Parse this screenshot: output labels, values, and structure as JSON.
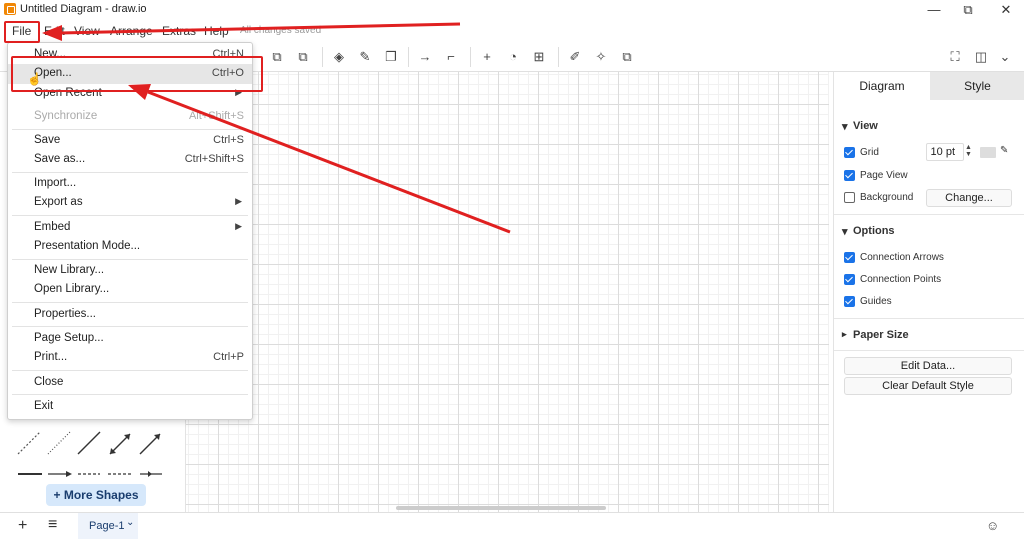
{
  "window": {
    "title": "Untitled Diagram - draw.io",
    "minimize": "—",
    "maximize": "⧉",
    "close": "✕"
  },
  "menubar": {
    "items": [
      "File",
      "Edit",
      "View",
      "Arrange",
      "Extras",
      "Help"
    ],
    "saved_status": "All changes saved"
  },
  "file_menu": {
    "items": [
      {
        "label": "New...",
        "shortcut": "Ctrl+N"
      },
      {
        "label": "Open...",
        "shortcut": "Ctrl+O"
      },
      {
        "label": "Open Recent",
        "submenu": "▶"
      },
      {
        "label": "Synchronize",
        "shortcut": "Alt+Shift+S"
      },
      {
        "label": "Save",
        "shortcut": "Ctrl+S"
      },
      {
        "label": "Save as...",
        "shortcut": "Ctrl+Shift+S"
      },
      {
        "label": "Import..."
      },
      {
        "label": "Export as",
        "submenu": "▶"
      },
      {
        "label": "Embed",
        "submenu": "▶"
      },
      {
        "label": "Presentation Mode..."
      },
      {
        "label": "New Library..."
      },
      {
        "label": "Open Library..."
      },
      {
        "label": "Properties..."
      },
      {
        "label": "Page Setup..."
      },
      {
        "label": "Print...",
        "shortcut": "Ctrl+P"
      },
      {
        "label": "Close"
      },
      {
        "label": "Exit"
      }
    ]
  },
  "left_panel": {
    "more_shapes": "+ More Shapes"
  },
  "right_panel": {
    "tabs": [
      "Diagram",
      "Style"
    ],
    "view_section": "View",
    "grid_label": "Grid",
    "grid_size": "10 pt",
    "page_view_label": "Page View",
    "background_label": "Background",
    "change_button": "Change...",
    "options_section": "Options",
    "connection_arrows": "Connection Arrows",
    "connection_points": "Connection Points",
    "guides": "Guides",
    "paper_size_section": "Paper Size",
    "edit_data": "Edit Data...",
    "clear_default_style": "Clear Default Style"
  },
  "statusbar": {
    "add": "+",
    "pages_menu": "≡",
    "page_tab": "Page-1",
    "page_tab_arrow": "⌄"
  },
  "colors": {
    "accent": "#1a73e8",
    "annotation_red": "#e02020",
    "more_shapes_bg": "#d6e8fb",
    "app_icon": "#f08705"
  }
}
